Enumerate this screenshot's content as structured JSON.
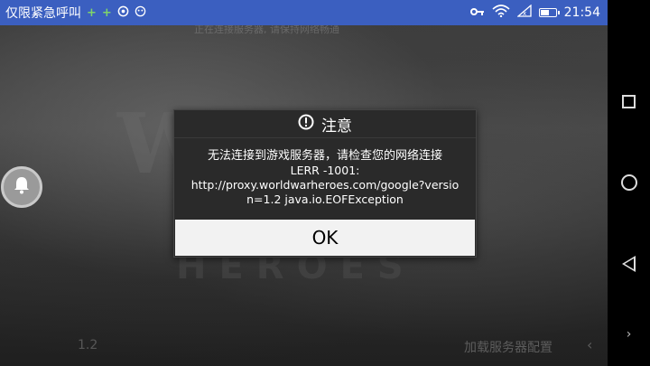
{
  "status_bar": {
    "title": "仅限紧急呼叫",
    "plus": "+",
    "time": "21:54",
    "battery_level": 0.55,
    "icons": [
      "key-icon",
      "wifi-icon",
      "signal-icon",
      "battery-icon"
    ],
    "color": "#3b5fc0"
  },
  "background": {
    "top_text": "正在连接服务器, 请保持网络畅通",
    "version": "1.2",
    "bottom_text": "加载服务器配置",
    "logo_text": "WAR",
    "logo_sub": "HEROES"
  },
  "dialog": {
    "title": "注意",
    "message_line1": "无法连接到游戏服务器，请检查您的网络连接",
    "message_line2": "LERR -1001:",
    "message_line3": "http://proxy.worldwarheroes.com/google?versio",
    "message_line4": "n=1.2 java.io.EOFException",
    "ok_label": "OK"
  },
  "nav_bar": {
    "buttons": [
      "recent-apps",
      "home",
      "back",
      "expand"
    ],
    "chevron": "›"
  }
}
